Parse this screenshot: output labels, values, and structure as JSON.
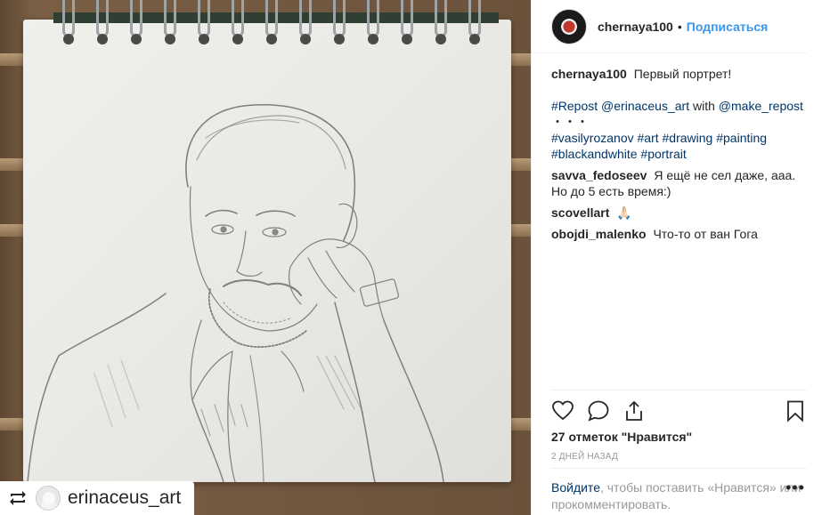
{
  "post": {
    "author": "chernaya100",
    "dot": "•",
    "follow_label": "Подписаться",
    "repost_badge_user": "erinaceus_art"
  },
  "comments": {
    "caption": {
      "user": "chernaya100",
      "text": "Первый портрет!",
      "repost_tag": "#Repost",
      "repost_mention": "@erinaceus_art",
      "with_word": "with",
      "app_mention": "@make_repost",
      "dots": "・・・",
      "hashtags": [
        "#vasilyrozanov",
        "#art",
        "#drawing",
        "#painting",
        "#blackandwhite",
        "#portrait"
      ]
    },
    "items": [
      {
        "user": "savva_fedoseev",
        "text": "Я ещё не сел даже, ааа. Но до 5 есть время:)"
      },
      {
        "user": "scovellart",
        "text": "🙏🏻"
      },
      {
        "user": "obojdi_malenko",
        "text": "Что-то от ван Гога"
      }
    ]
  },
  "actions": {
    "like_icon": "heart-icon",
    "comment_icon": "comment-icon",
    "share_icon": "share-icon",
    "save_icon": "bookmark-icon"
  },
  "likes_text": "27 отметок \"Нравится\"",
  "timestamp": "2 дней назад",
  "footer": {
    "login_link": "Войдите",
    "login_text": ", чтобы поставить «Нравится» или прокомментировать.",
    "more": "•••"
  },
  "colors": {
    "link": "#3897f0",
    "hashtag": "#003569",
    "muted": "#999999"
  }
}
